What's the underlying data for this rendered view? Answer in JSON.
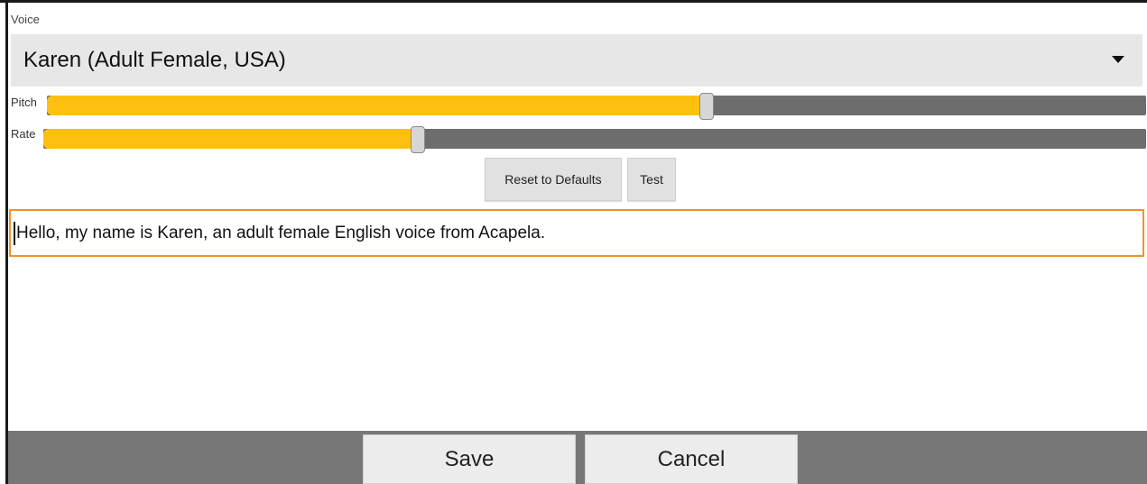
{
  "voice": {
    "label": "Voice",
    "selected": "Karen (Adult Female, USA)",
    "dropdown_icon": "triangle-down-icon"
  },
  "pitch": {
    "label": "Pitch",
    "value_fraction": 0.6
  },
  "rate": {
    "label": "Rate",
    "value_fraction": 0.34
  },
  "buttons": {
    "reset_label": "Reset to Defaults",
    "test_label": "Test",
    "save_label": "Save",
    "cancel_label": "Cancel"
  },
  "sample_text": {
    "value": "Hello, my name is Karen, an adult female English voice from Acapela."
  },
  "colors": {
    "slider_fill": "#fdc010",
    "slider_track": "#6d6d6d",
    "input_focus_border": "#f0932a",
    "bottom_bar": "#777777"
  }
}
